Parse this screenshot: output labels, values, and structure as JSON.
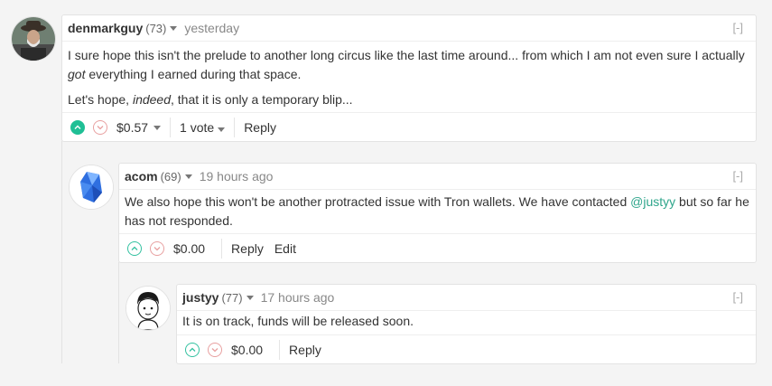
{
  "comments": [
    {
      "author": "denmarkguy",
      "reputation": "(73)",
      "time": "yesterday",
      "collapse": "[-]",
      "body": [
        [
          "I sure hope this isn't the prelude to another long circus like the last time around... from which I am not even sure I actually ",
          "got",
          " everything I earned during that space."
        ],
        [
          "Let's hope, ",
          "indeed",
          ", that it is only a temporary blip..."
        ]
      ],
      "payout": "$0.57",
      "votes": "1 vote",
      "reply_label": "Reply"
    },
    {
      "author": "acom",
      "reputation": "(69)",
      "time": "19 hours ago",
      "collapse": "[-]",
      "body_before": "We also hope this won't be another protracted issue with Tron wallets. We have contacted ",
      "mention": "@justyy",
      "body_after": " but so far he has not responded.",
      "payout": "$0.00",
      "reply_label": "Reply",
      "edit_label": "Edit"
    },
    {
      "author": "justyy",
      "reputation": "(77)",
      "time": "17 hours ago",
      "collapse": "[-]",
      "body": "It is on track, funds will be released soon.",
      "payout": "$0.00",
      "reply_label": "Reply"
    }
  ],
  "colors": {
    "upvote_active": "#1fbf95",
    "upvote_outline": "#33c1a0",
    "downvote_outline": "#e8a0a0",
    "mention": "#2ea58b"
  },
  "icons": [
    "upvote-icon",
    "downvote-icon",
    "chevron-down-icon"
  ]
}
